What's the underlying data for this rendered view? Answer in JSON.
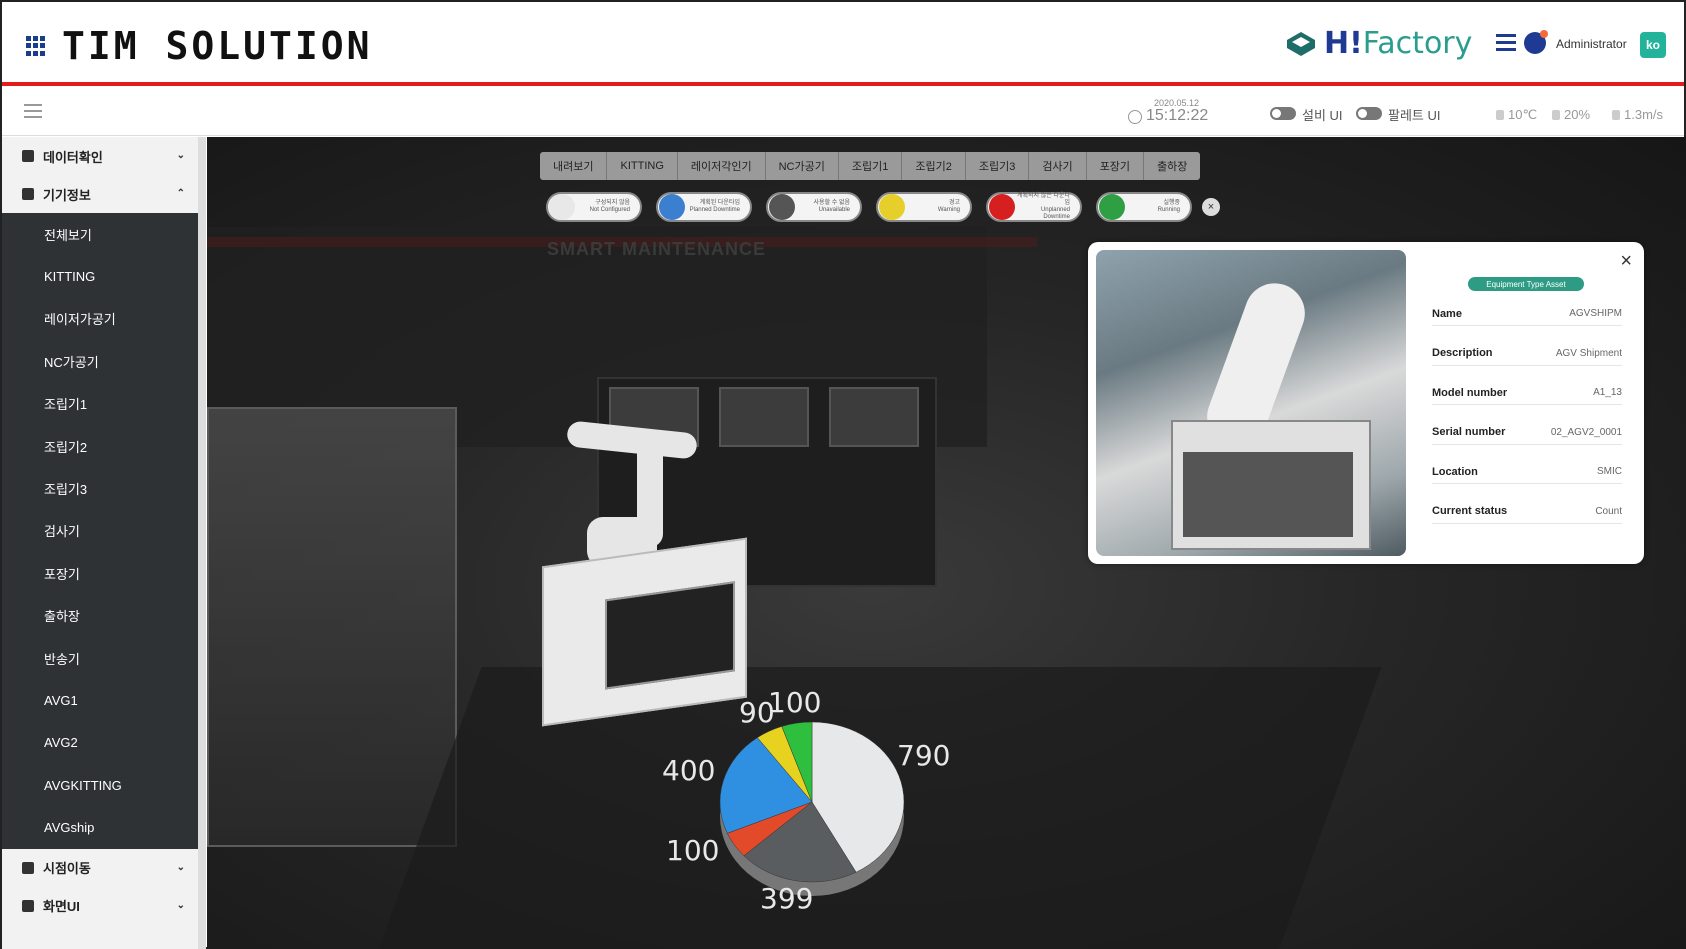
{
  "header": {
    "brand": "TIM SOLUTION",
    "product_prefix": "H!",
    "product_suffix": "Factory",
    "admin": "Administrator",
    "lang": "ko"
  },
  "subbar": {
    "date": "2020.05.12",
    "time": "15:12:22",
    "toggle1": "설비 UI",
    "toggle2": "팔레트 UI",
    "temp": "10℃",
    "humidity": "20%",
    "wind": "1.3m/s"
  },
  "sidebar": {
    "sections": [
      {
        "label": "데이터확인",
        "chev": "⌄",
        "icon": "layers-icon"
      },
      {
        "label": "기기정보",
        "chev": "⌃",
        "icon": "gear-icon"
      }
    ],
    "items": [
      "전체보기",
      "KITTING",
      "레이저가공기",
      "NC가공기",
      "조립기1",
      "조립기2",
      "조립기3",
      "검사기",
      "포장기",
      "출하장",
      "반송기",
      "AVG1",
      "AVG2",
      "AVGKITTING",
      "AVGship"
    ],
    "active_index": 14,
    "bottom_sections": [
      {
        "label": "시점이동",
        "chev": "⌄",
        "icon": "camera-icon"
      },
      {
        "label": "화면UI",
        "chev": "⌄",
        "icon": "gear-icon"
      }
    ]
  },
  "scene": {
    "watermark": "SMART MAINTENANCE"
  },
  "tabs": [
    "내려보기",
    "KITTING",
    "레이저각인기",
    "NC가공기",
    "조립기1",
    "조립기2",
    "조립기3",
    "검사기",
    "포장기",
    "출하장"
  ],
  "status_pills": [
    {
      "color": "#e8e8e8",
      "label": "구성되지 않음",
      "sub": "Not Configured"
    },
    {
      "color": "#3a7fd0",
      "label": "계획된 다운타임",
      "sub": "Planned Downtime"
    },
    {
      "color": "#555555",
      "label": "사용할 수 없음",
      "sub": "Unavailable"
    },
    {
      "color": "#e6cf2a",
      "label": "경고",
      "sub": "Warning"
    },
    {
      "color": "#d62020",
      "label": "계획되지 않은 다운타임",
      "sub": "Unplanned Downtime"
    },
    {
      "color": "#2ea043",
      "label": "실행중",
      "sub": "Running"
    }
  ],
  "status_close": "×",
  "infocard": {
    "close": "×",
    "badge": "Equipment Type Asset",
    "rows": [
      {
        "k": "Name",
        "v": "AGVSHIPM"
      },
      {
        "k": "Description",
        "v": "AGV Shipment"
      },
      {
        "k": "Model number",
        "v": "A1_13"
      },
      {
        "k": "Serial number",
        "v": "02_AGV2_0001"
      },
      {
        "k": "Location",
        "v": "SMIC"
      },
      {
        "k": "Current status",
        "v": "Count"
      }
    ]
  },
  "chart_data": {
    "type": "pie",
    "values": [
      790,
      399,
      100,
      400,
      90,
      100
    ],
    "colors": [
      "#e6e8ea",
      "#5a5d60",
      "#e24a2a",
      "#2f8fe0",
      "#e6d21f",
      "#2fbf3f"
    ],
    "labels": [
      "790",
      "399",
      "100",
      "400",
      "90",
      "100"
    ]
  }
}
